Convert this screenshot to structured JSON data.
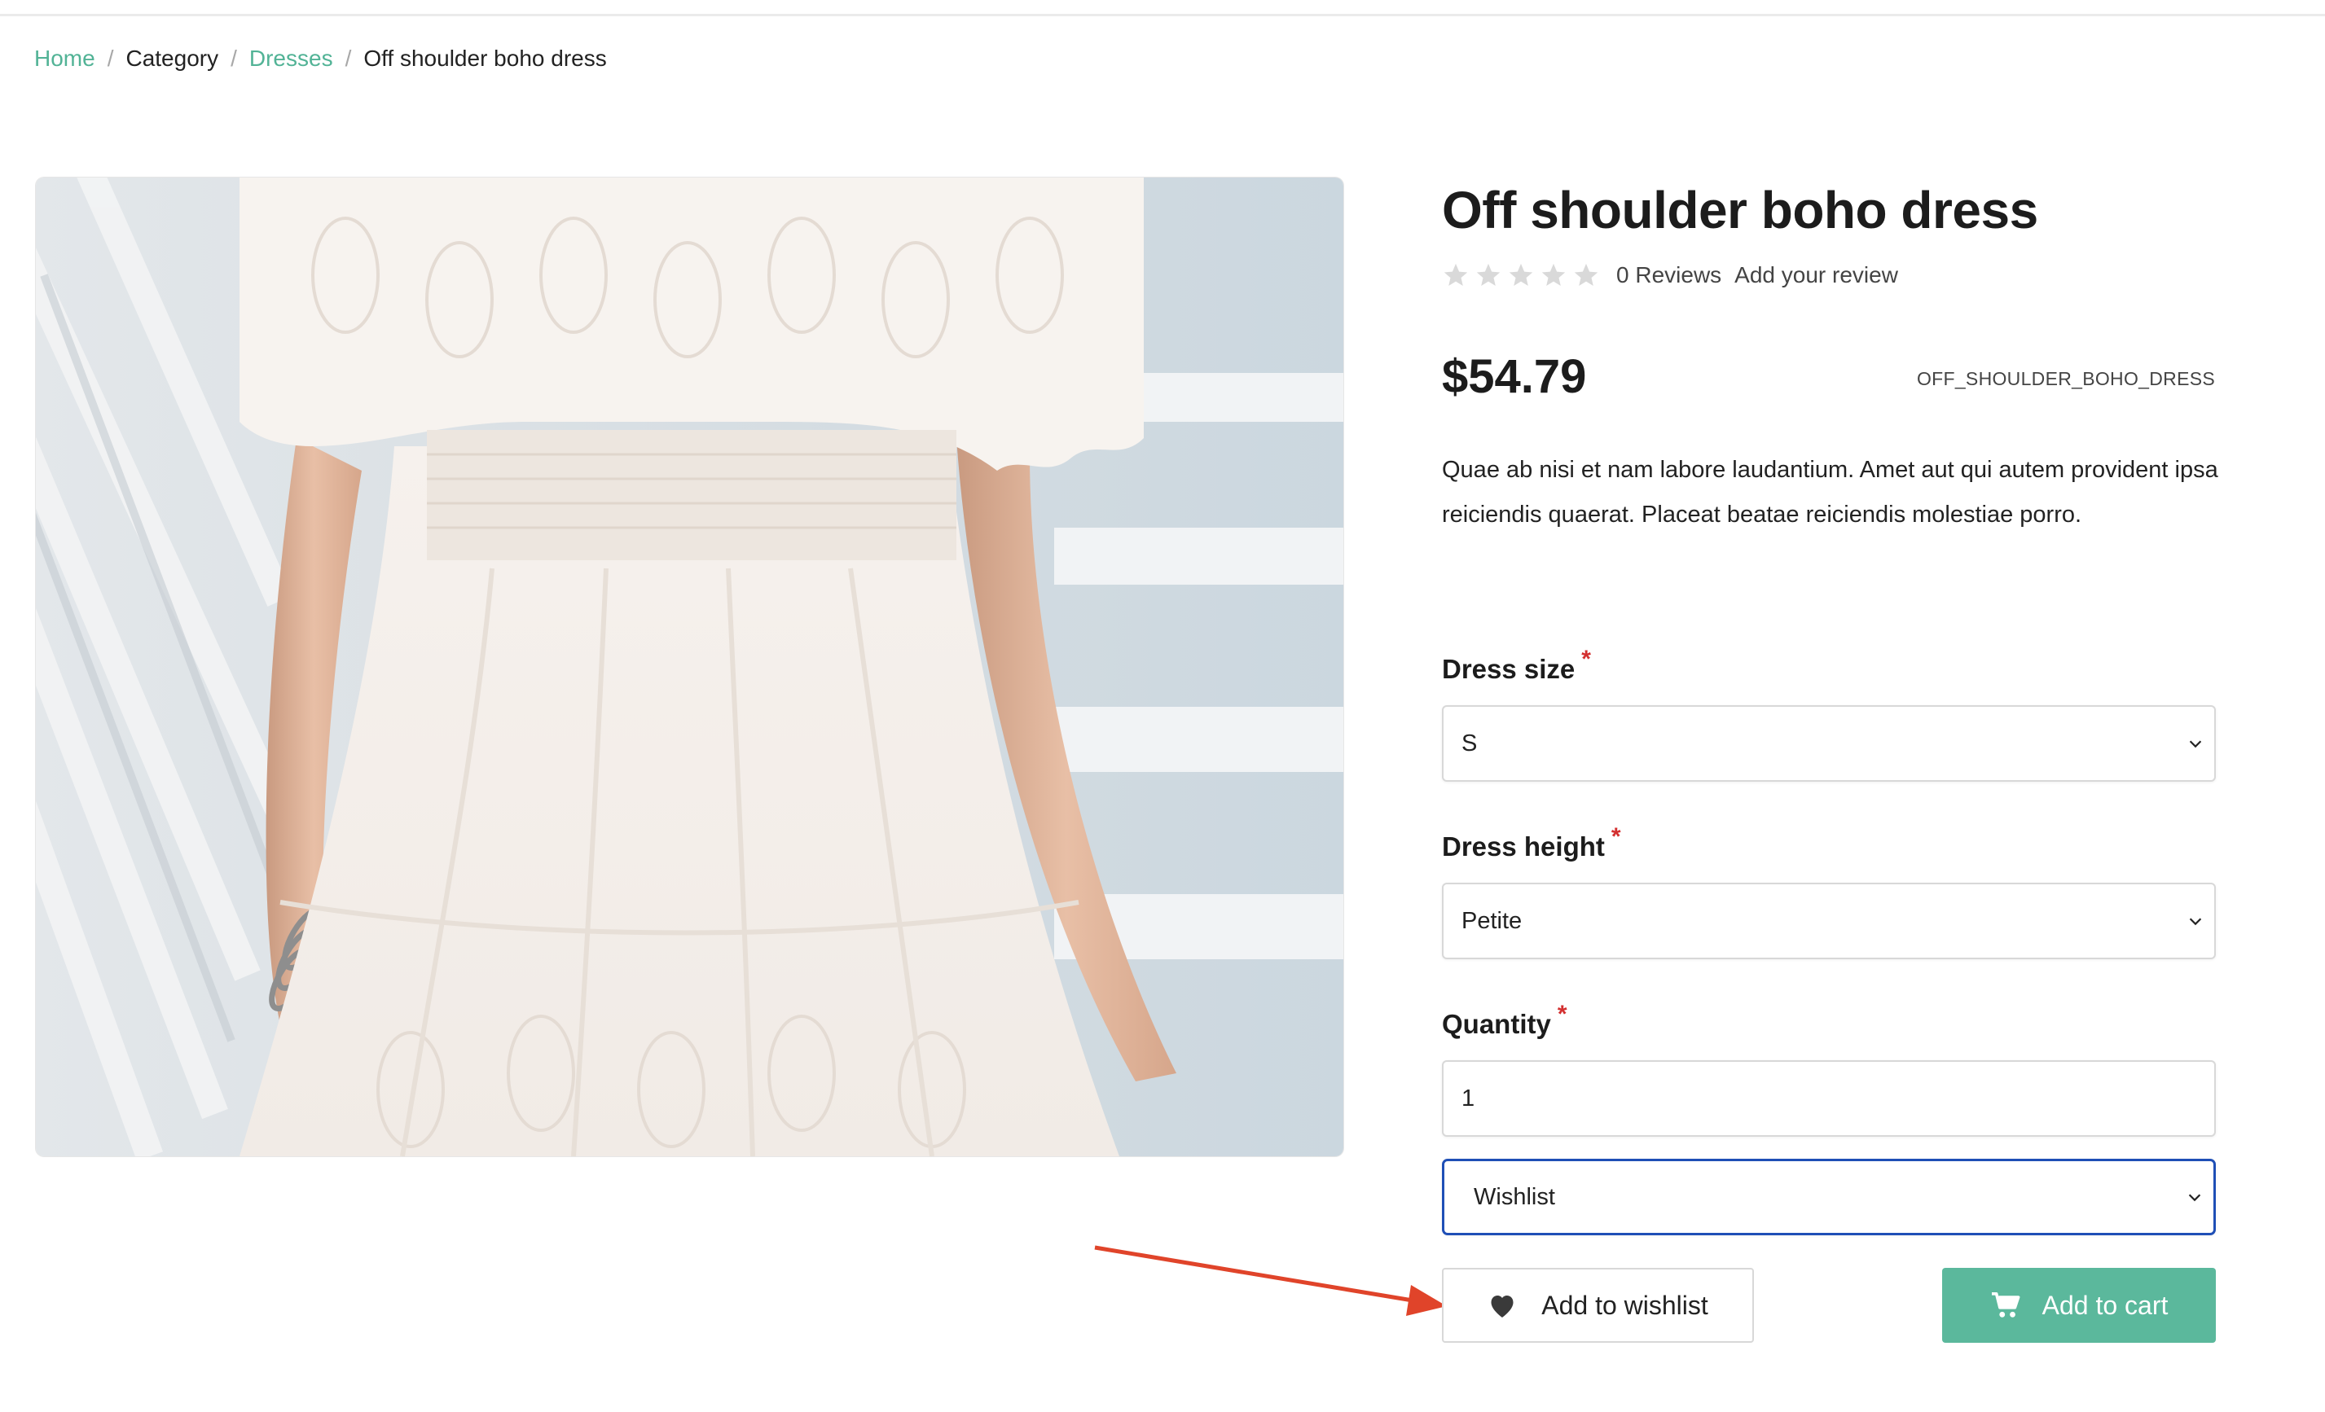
{
  "breadcrumb": {
    "home": "Home",
    "category": "Category",
    "dresses": "Dresses",
    "current": "Off shoulder boho dress",
    "separator": "/"
  },
  "product": {
    "title": "Off shoulder boho dress",
    "rating": {
      "stars": 0,
      "max_stars": 5
    },
    "reviews_count": "0 Reviews",
    "add_review": "Add your review",
    "price": "$54.79",
    "sku": "OFF_SHOULDER_BOHO_DRESS",
    "description": "Quae ab nisi et nam labore laudantium. Amet aut qui autem provident ipsa reiciendis quaerat. Placeat beatae reiciendis molestiae porro."
  },
  "options": {
    "dress_size": {
      "label": "Dress size",
      "required": "*",
      "value": "S"
    },
    "dress_height": {
      "label": "Dress height",
      "required": "*",
      "value": "Petite"
    },
    "quantity": {
      "label": "Quantity",
      "required": "*",
      "value": "1"
    },
    "wishlist_select": {
      "value": "Wishlist"
    }
  },
  "actions": {
    "add_to_wishlist": "Add to wishlist",
    "add_to_cart": "Add to cart"
  },
  "colors": {
    "accent": "#5bb89c",
    "link": "#52b396",
    "required": "#d32f2f",
    "focus": "#1f4fb6",
    "annotation_arrow": "#e0442a"
  },
  "icons": {
    "stars": "star-icon",
    "wishlist": "heart-icon",
    "cart": "cart-icon",
    "select": "chevron-down-icon"
  }
}
